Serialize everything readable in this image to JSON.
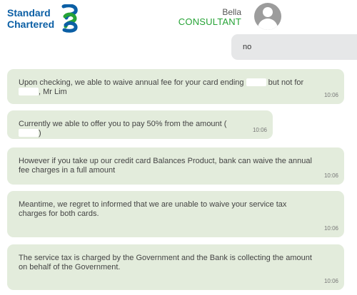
{
  "brand": {
    "line1": "Standard",
    "line2": "Chartered",
    "colors": {
      "blue": "#0b5fa5",
      "green": "#26a336"
    }
  },
  "agent": {
    "name": "Bella",
    "role": "CONSULTANT",
    "avatar_icon": "user-avatar-icon"
  },
  "user_message": {
    "text": "no"
  },
  "messages": [
    {
      "text_a": "Upon checking, we able to waive annual fee for your card ending",
      "text_b": "but not for",
      "text_c": ", Mr Lim",
      "time": "10:06"
    },
    {
      "text_a": "Currently we able to offer you to pay 50% from the amount (",
      "text_b": ")",
      "time": "10:06"
    },
    {
      "text": "However if you take up our credit card Balances Product, bank can waive the annual fee charges in a full amount",
      "time": "10:06"
    },
    {
      "text": "Meantime, we regret to informed that we are unable to waive your service tax charges for both cards.",
      "time": "10:06"
    },
    {
      "text": "The service tax is charged by the Government and the Bank is collecting the amount on behalf of the Government.",
      "time": "10:06"
    }
  ]
}
